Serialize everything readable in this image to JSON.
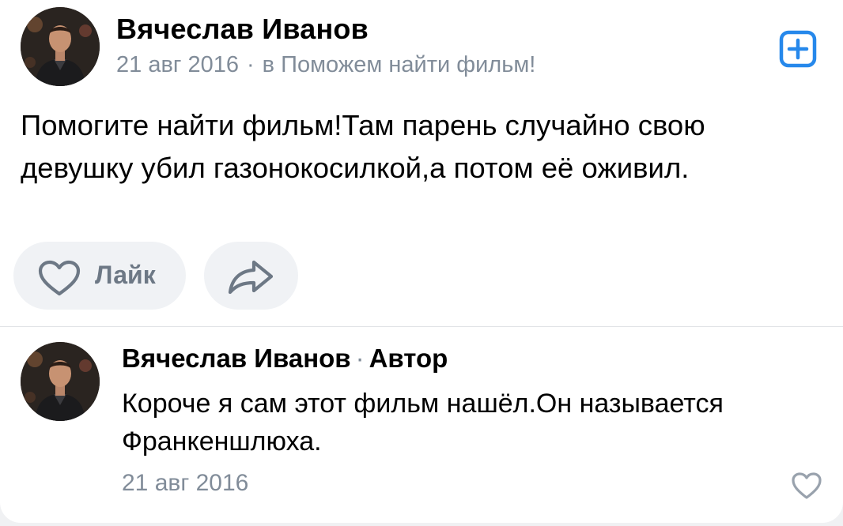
{
  "post": {
    "author": "Вячеслав Иванов",
    "date": "21 авг 2016",
    "separator": "·",
    "community": "в Поможем найти фильм!",
    "text_lines": [
      "Помогите найти фильм!Там парень случайно свою",
      "девушку убил газонокосилкой,а потом её оживил."
    ],
    "like_label": "Лайк",
    "icons": {
      "subscribe": "plus-square-icon",
      "like": "heart-outline-icon",
      "share": "share-arrow-icon",
      "avatar": "profile-photo"
    }
  },
  "comment": {
    "author": "Вячеслав Иванов",
    "separator": "·",
    "badge": "Автор",
    "text_lines": [
      "Короче я сам этот фильм нашёл.Он называется",
      "Франкеншлюха."
    ],
    "date": "21 авг 2016",
    "icons": {
      "like": "heart-outline-icon"
    }
  },
  "colors": {
    "accent": "#2688eb",
    "secondary_text": "#818c99",
    "button_bg": "#f0f2f5",
    "button_icon": "#6d7885"
  }
}
